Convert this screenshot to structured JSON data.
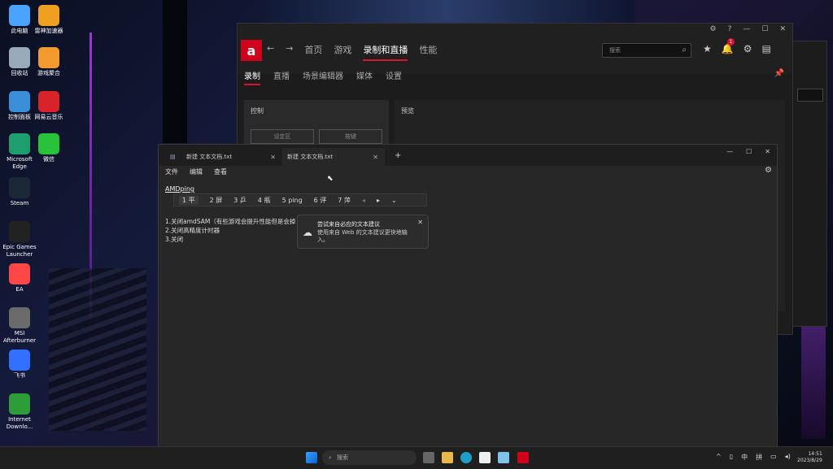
{
  "desktop_icons": [
    {
      "label": "此电脑",
      "icon": "computer-icon",
      "color": "#4aa3ff"
    },
    {
      "label": "雷神加速器",
      "icon": "leishen-icon",
      "color": "#f0a020"
    },
    {
      "label": "回收站",
      "icon": "recycle-bin-icon",
      "color": "#9ab"
    },
    {
      "label": "游戏聚合",
      "icon": "game-hub-icon",
      "color": "#f29a2e"
    },
    {
      "label": "控制面板",
      "icon": "control-panel-icon",
      "color": "#3b8fd9"
    },
    {
      "label": "网易云音乐",
      "icon": "netease-music-icon",
      "color": "#d8232a"
    },
    {
      "label": "Microsoft Edge",
      "icon": "edge-icon",
      "color": "#1e9e6e"
    },
    {
      "label": "微信",
      "icon": "wechat-icon",
      "color": "#29c23b"
    },
    {
      "label": "Steam",
      "icon": "steam-icon",
      "color": "#1b2838"
    },
    {
      "label": "Epic Games Launcher",
      "icon": "epic-icon",
      "color": "#222"
    },
    {
      "label": "EA",
      "icon": "ea-icon",
      "color": "#ff4747"
    },
    {
      "label": "MSI Afterburner",
      "icon": "msi-icon",
      "color": "#6b6b6b"
    },
    {
      "label": "飞书",
      "icon": "feishu-icon",
      "color": "#3370ff"
    },
    {
      "label": "Internet Downlo...",
      "icon": "idm-icon",
      "color": "#2f9c3a"
    }
  ],
  "amd": {
    "nav": [
      "首页",
      "游戏",
      "录制和直播",
      "性能"
    ],
    "nav_active": 2,
    "search_placeholder": "搜索",
    "subtabs": [
      "录制",
      "直播",
      "场景编辑器",
      "媒体",
      "设置"
    ],
    "subtab_active": 0,
    "panel_left_title": "控制",
    "panel_right_title": "预览",
    "btn1": "设定区",
    "btn2": "按键",
    "notif_count": "1"
  },
  "notepad": {
    "tabs": [
      {
        "label": "新建 文本文档.txt"
      },
      {
        "label": "新建 文本文档.txt"
      }
    ],
    "menu": [
      "文件",
      "编辑",
      "查看"
    ],
    "input_text": "AMDping",
    "candidates": [
      "1 平",
      "2 屏",
      "3 乒",
      "4 瓶",
      "5 ping",
      "6 评",
      "7 萍"
    ],
    "lines": [
      "1.关闭amdSAM（有些游戏会提升性能但是会掉",
      "2.关闭高精度计时器",
      "3.关闭"
    ],
    "tip_title": "尝试来自必应的文本建议",
    "tip_body": "使用来自 Web 的文本建议更快地输入。"
  },
  "taskbar": {
    "search_placeholder": "搜索",
    "time": "14:51",
    "date": "2023/8/29",
    "ime": "中",
    "lang": "拼"
  }
}
